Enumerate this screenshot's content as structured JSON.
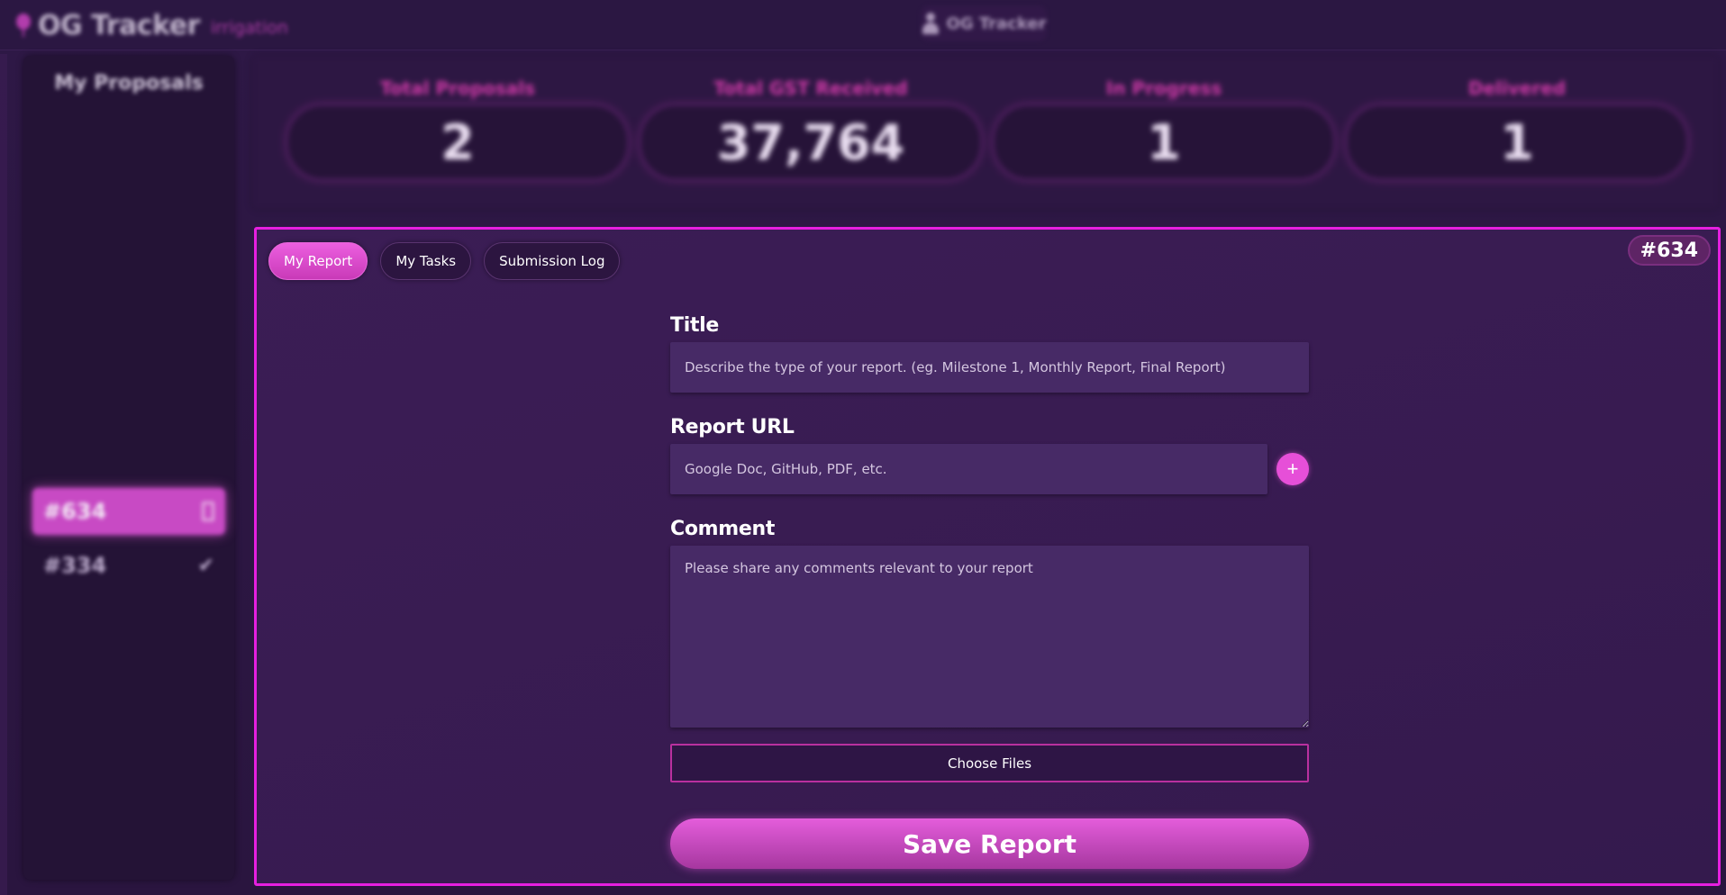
{
  "header": {
    "app_title": "OG Tracker",
    "app_subtitle": "irrigation",
    "user_label": "OG Tracker"
  },
  "sidebar": {
    "title": "My Proposals",
    "items": [
      {
        "label": "#634",
        "status_icon": "hourglass-icon",
        "active": true
      },
      {
        "label": "#334",
        "status_icon": "check-icon",
        "active": false
      }
    ]
  },
  "stats": [
    {
      "label": "Total Proposals",
      "value": "2"
    },
    {
      "label": "Total GST Received",
      "value": "37,764"
    },
    {
      "label": "In Progress",
      "value": "1"
    },
    {
      "label": "Delivered",
      "value": "1"
    }
  ],
  "main": {
    "proposal_id": "#634",
    "tabs": [
      {
        "label": "My Report",
        "active": true
      },
      {
        "label": "My Tasks",
        "active": false
      },
      {
        "label": "Submission Log",
        "active": false
      }
    ],
    "form": {
      "title_label": "Title",
      "title_placeholder": "Describe the type of your report. (eg. Milestone 1, Monthly Report, Final Report)",
      "url_label": "Report URL",
      "url_placeholder": "Google Doc, GitHub, PDF, etc.",
      "add_url_symbol": "+",
      "comment_label": "Comment",
      "comment_placeholder": "Please share any comments relevant to your report",
      "choose_files_label": "Choose Files",
      "save_label": "Save Report"
    }
  },
  "colors": {
    "accent": "#e61fe0",
    "button_pink": "#e64fd8",
    "background": "#2e1846",
    "input_bg": "#472a66"
  }
}
